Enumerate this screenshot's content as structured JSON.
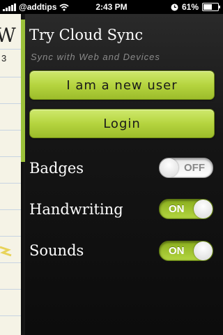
{
  "status_bar": {
    "carrier": "@addtips",
    "time": "2:43 PM",
    "battery": "61%",
    "battery_level": 0.61,
    "icons": [
      "signal-bars-icon",
      "wifi-icon",
      "clock-icon",
      "battery-icon"
    ]
  },
  "notebook": {
    "partial_text_1": "W",
    "partial_text_2": "3"
  },
  "panel": {
    "title": "Try Cloud Sync",
    "subtitle": "Sync with Web and Devices",
    "new_user_button": "I am a new user",
    "login_button": "Login"
  },
  "settings": [
    {
      "label": "Badges",
      "state": "OFF"
    },
    {
      "label": "Handwriting",
      "state": "ON"
    },
    {
      "label": "Sounds",
      "state": "ON"
    }
  ],
  "colors": {
    "accent_green": "#b5d43f",
    "panel_bg": "#151515"
  }
}
